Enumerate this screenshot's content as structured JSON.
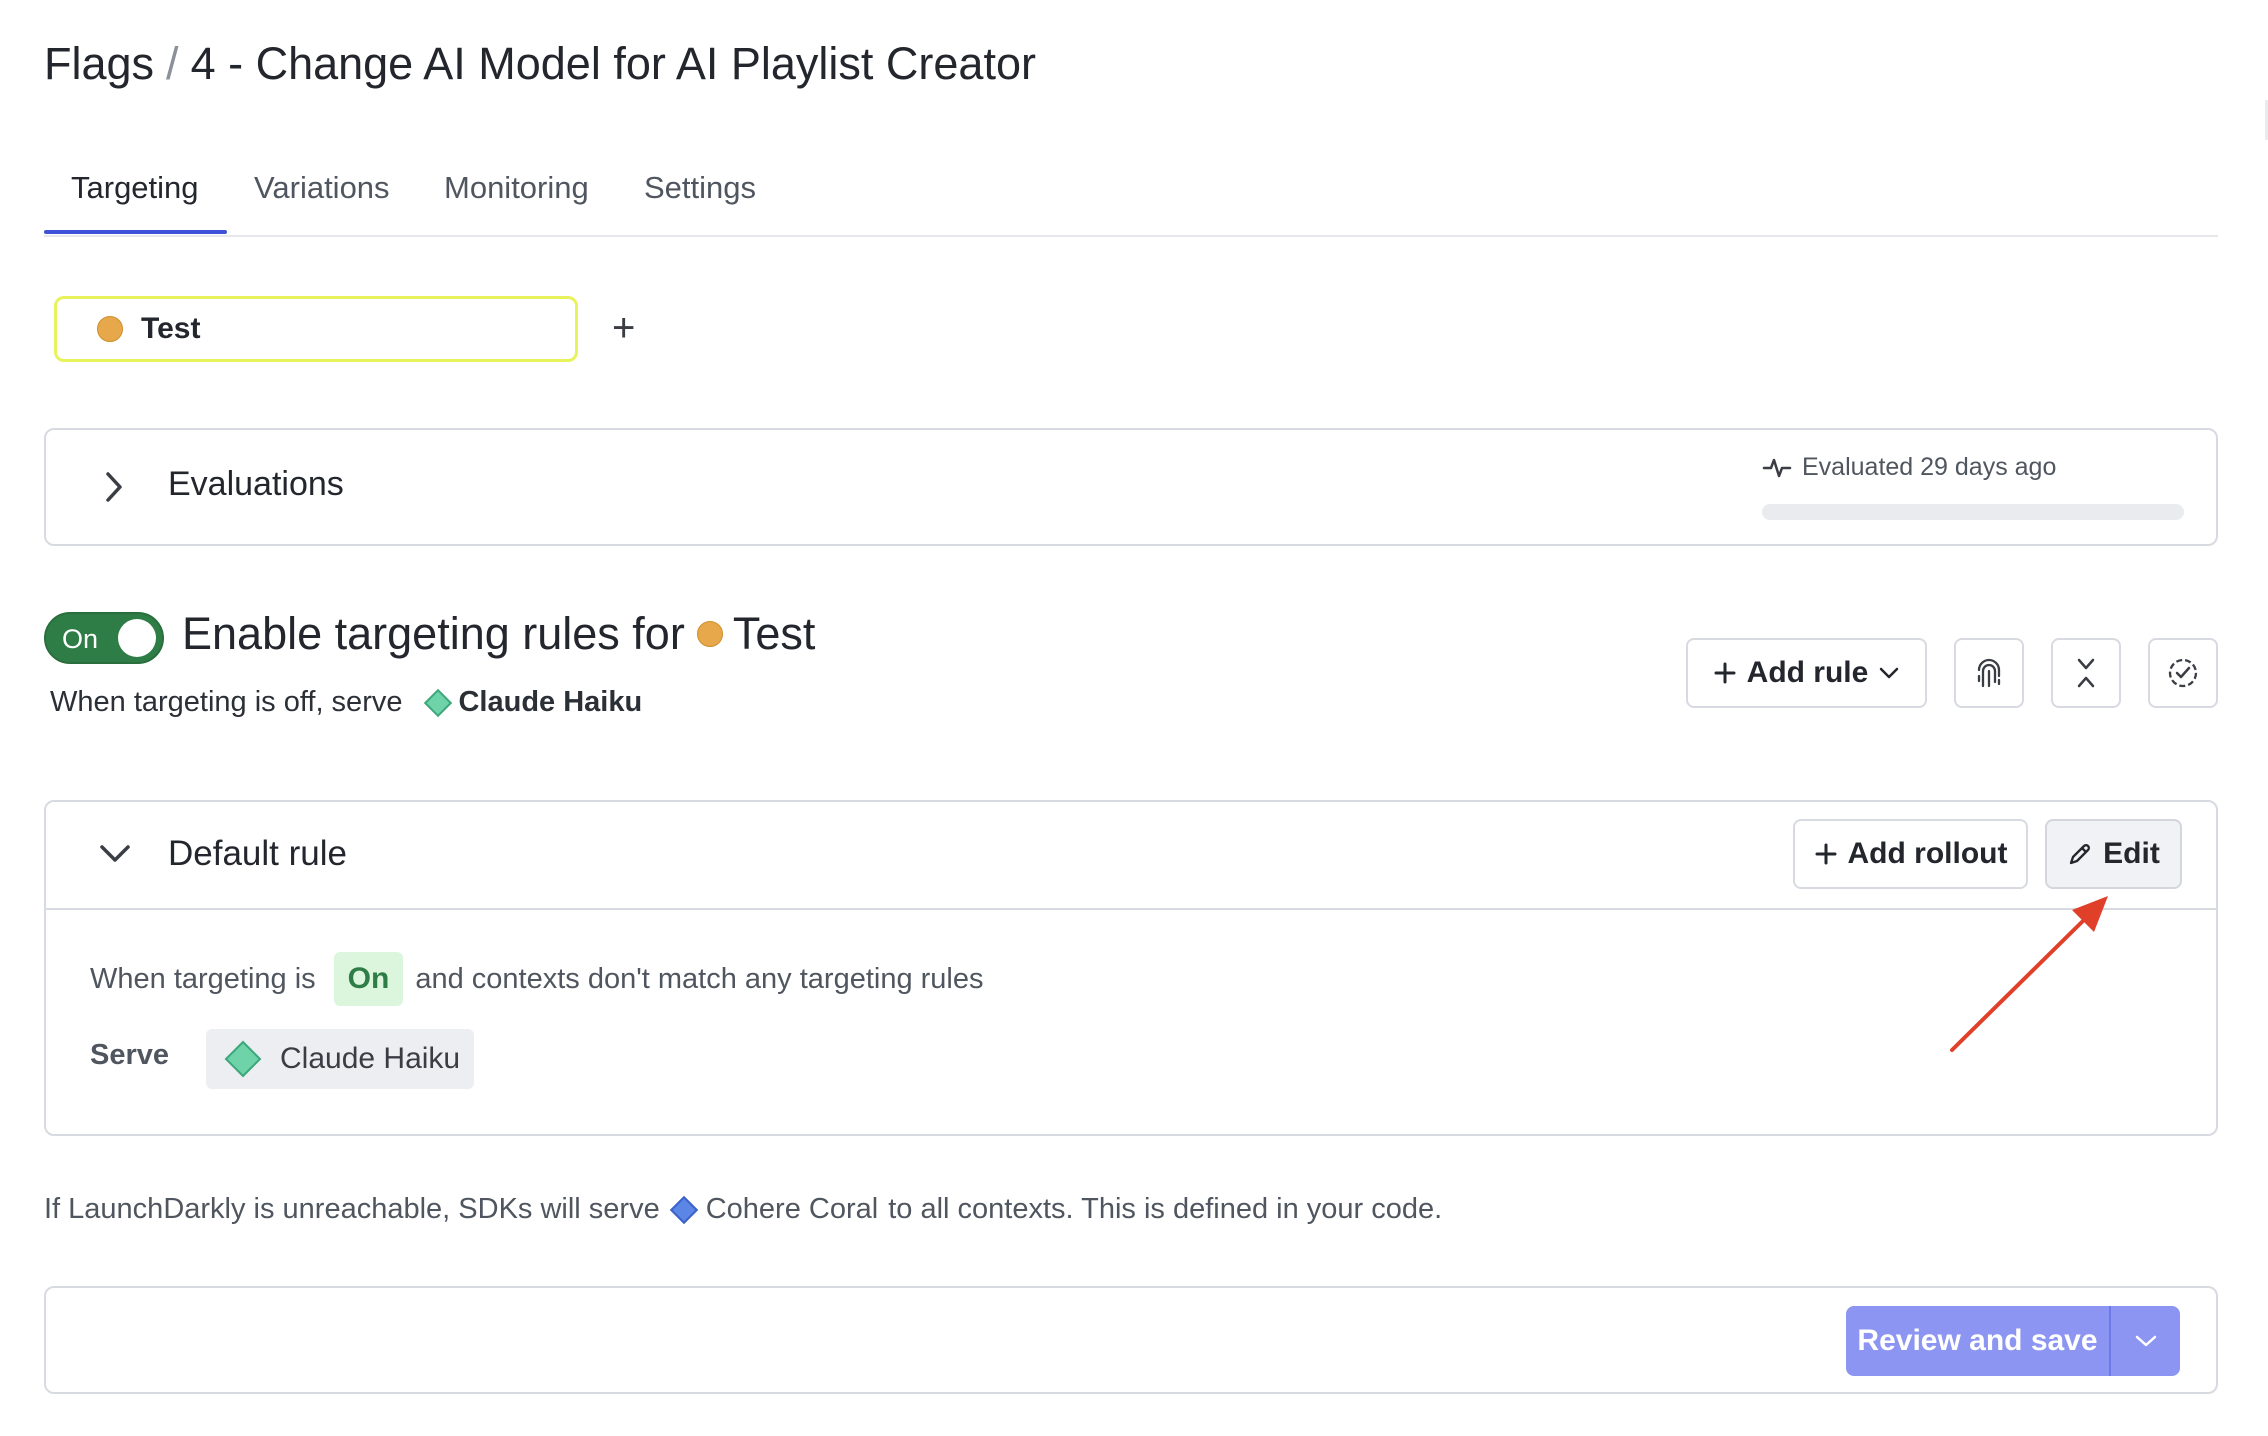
{
  "header": {
    "breadcrumb_root": "Flags",
    "separator": "/",
    "flag_title": "4 - Change AI Model for AI Playlist Creator"
  },
  "tabs": [
    {
      "label": "Targeting",
      "active": true
    },
    {
      "label": "Variations",
      "active": false
    },
    {
      "label": "Monitoring",
      "active": false
    },
    {
      "label": "Settings",
      "active": false
    }
  ],
  "environment": {
    "name": "Test",
    "color": "#e6a84a",
    "add_symbol": "+"
  },
  "evaluations": {
    "title": "Evaluations",
    "meta": "Evaluated 29 days ago",
    "progress": 0
  },
  "targeting": {
    "toggle_label": "On",
    "title_prefix": "Enable targeting rules for",
    "env_name": "Test",
    "off_text": "When targeting is off, serve",
    "off_variation": "Claude Haiku",
    "add_rule_label": "Add rule"
  },
  "default_rule": {
    "title": "Default rule",
    "add_rollout_label": "Add rollout",
    "edit_label": "Edit",
    "when_prefix": "When targeting is",
    "state_badge": "On",
    "when_suffix": "and contexts don't match any targeting rules",
    "serve_label": "Serve",
    "serve_variation": "Claude Haiku"
  },
  "fallback": {
    "prefix": "If LaunchDarkly is unreachable, SDKs will serve",
    "variation": "Cohere Coral",
    "suffix": "to all contexts. This is defined in your code."
  },
  "footer": {
    "save_label": "Review and save"
  },
  "colors": {
    "accent": "#3f51d8",
    "toggle_on": "#2f7d46",
    "variation_green": "#6fd3a9",
    "variation_blue": "#5b86e5",
    "save_button": "#8c96f2",
    "annotation_arrow": "#e0402a"
  }
}
